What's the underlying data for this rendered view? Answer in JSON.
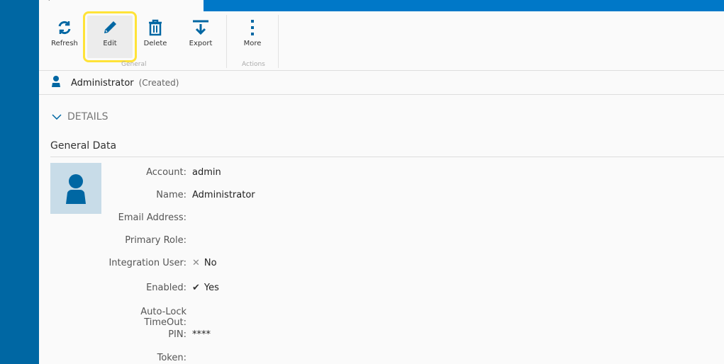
{
  "toolbar": {
    "refresh": "Refresh",
    "edit": "Edit",
    "delete": "Delete",
    "export": "Export",
    "more": "More",
    "group_general": "General",
    "group_actions": "Actions"
  },
  "record": {
    "name": "Administrator",
    "status": "(Created)"
  },
  "section": {
    "title": "DETAILS",
    "subtitle": "General Data"
  },
  "fields": [
    {
      "label": "Account:",
      "value": "admin"
    },
    {
      "label": "Name:",
      "value": "Administrator"
    },
    {
      "label": "Email Address:",
      "value": ""
    },
    {
      "label": "Primary Role:",
      "value": ""
    },
    {
      "label": "Integration User:",
      "value": "No"
    },
    {
      "label": "Enabled:",
      "value": "Yes"
    },
    {
      "label": "Auto-Lock TimeOut:",
      "value": ""
    },
    {
      "label": "PIN:",
      "value": "****"
    },
    {
      "label": "Token:",
      "value": ""
    }
  ],
  "colors": {
    "accent": "#0067a3",
    "highlight": "#ffe338"
  }
}
